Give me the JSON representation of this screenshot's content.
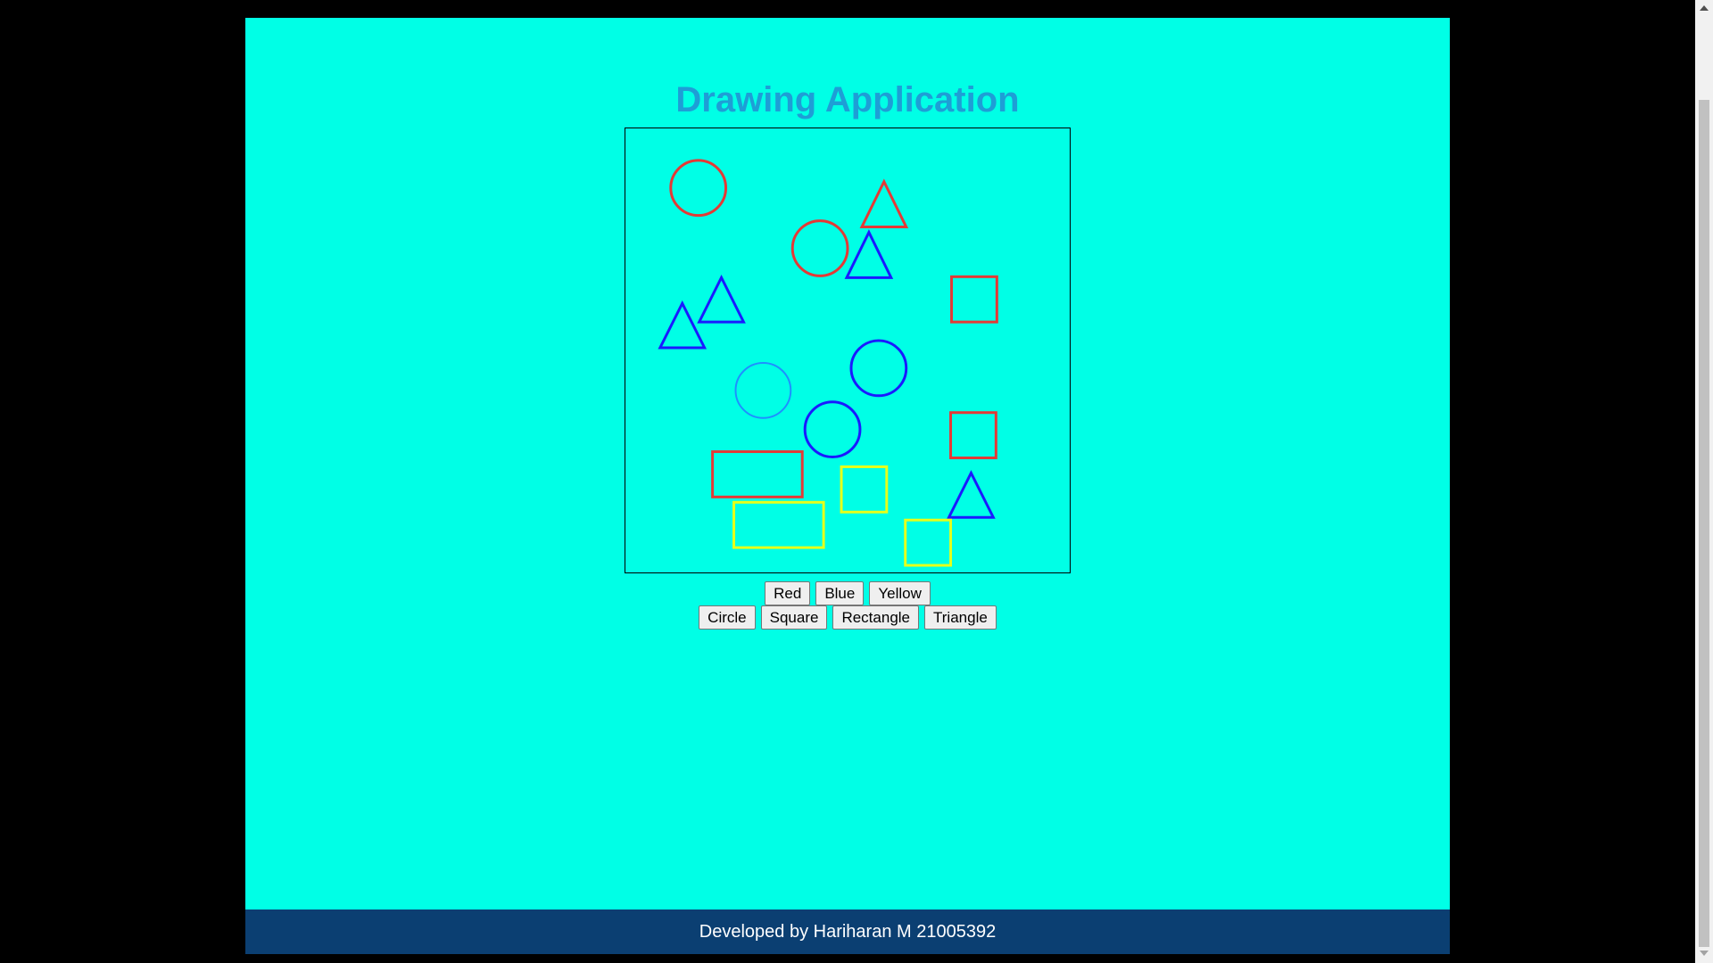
{
  "title": "Drawing Application",
  "colors": {
    "page_bg": "#00ffe6",
    "title": "#1e9ed6",
    "footer_bg": "#0b3f72",
    "red": "#e53935",
    "blue": "#1a1aff",
    "yellow": "#e6ff1a",
    "light_blue": "#1e90ff"
  },
  "color_buttons": [
    "Red",
    "Blue",
    "Yellow"
  ],
  "shape_buttons": [
    "Circle",
    "Square",
    "Rectangle",
    "Triangle"
  ],
  "canvas_shapes": [
    {
      "shape": "circle",
      "color": "red"
    },
    {
      "shape": "triangle",
      "color": "red"
    },
    {
      "shape": "circle",
      "color": "red"
    },
    {
      "shape": "triangle",
      "color": "blue"
    },
    {
      "shape": "square",
      "color": "red"
    },
    {
      "shape": "triangle",
      "color": "blue"
    },
    {
      "shape": "triangle",
      "color": "blue"
    },
    {
      "shape": "circle",
      "color": "blue"
    },
    {
      "shape": "circle",
      "color": "light_blue"
    },
    {
      "shape": "circle",
      "color": "blue"
    },
    {
      "shape": "square",
      "color": "red"
    },
    {
      "shape": "rectangle",
      "color": "red"
    },
    {
      "shape": "square",
      "color": "yellow"
    },
    {
      "shape": "triangle",
      "color": "blue"
    },
    {
      "shape": "rectangle",
      "color": "yellow"
    },
    {
      "shape": "square",
      "color": "yellow"
    }
  ],
  "footer": "Developed by Hariharan M 21005392"
}
